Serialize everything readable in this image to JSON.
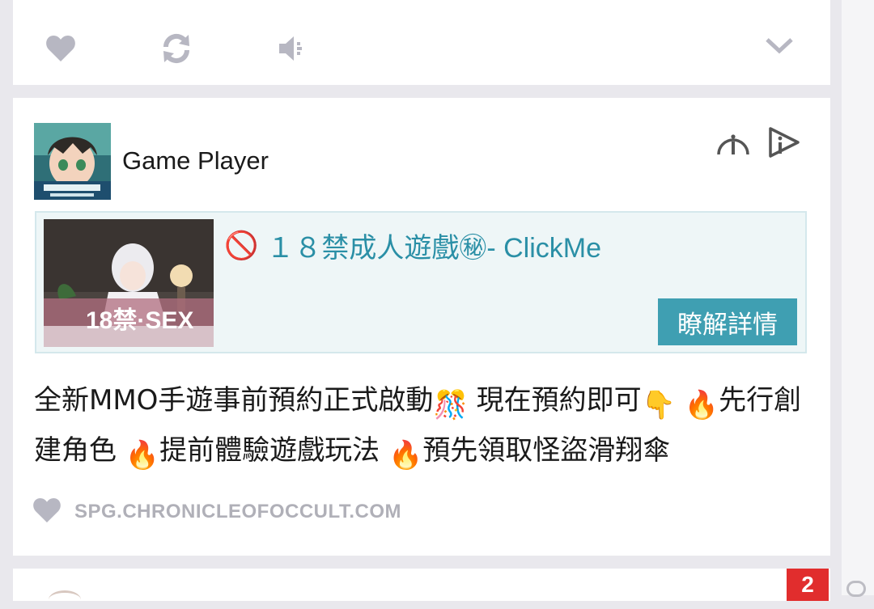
{
  "previous_post": {
    "actions": [
      {
        "name": "like-icon"
      },
      {
        "name": "repost-icon"
      },
      {
        "name": "speaker-icon"
      },
      {
        "name": "chevron-down-icon"
      }
    ]
  },
  "post": {
    "author": "Game Player",
    "avatar_icon": "game-avatar-image",
    "ad": {
      "prohibited_icon": "🚫",
      "title": "１８禁成人遊戲㊙- ClickMe",
      "image_label": "18禁·SEX",
      "cta_label": "瞭解詳情"
    },
    "text_segments": [
      {
        "text": "全新MMO手遊事前預約正式啟動"
      },
      {
        "emoji": "🎊"
      },
      {
        "text": " 現在預約即可"
      },
      {
        "emoji": "👇"
      },
      {
        "text": " "
      },
      {
        "emoji": "🔥"
      },
      {
        "text": "先行創建角色 "
      },
      {
        "emoji": "🔥"
      },
      {
        "text": "提前體驗遊戲玩法 "
      },
      {
        "emoji": "🔥"
      },
      {
        "text": "預先領取怪盜滑翔傘"
      }
    ],
    "source_link": "SPG.CHRONICLEOFOCCULT.COM"
  },
  "next_post": {
    "badge_count": "2"
  },
  "colors": {
    "background": "#e9e8ed",
    "card": "#ffffff",
    "ad_background": "#eef6f7",
    "ad_title": "#2a8fa6",
    "cta_button": "#3f9fb2",
    "icon_gray": "#b7b7c2",
    "badge_red": "#e12d2d"
  }
}
